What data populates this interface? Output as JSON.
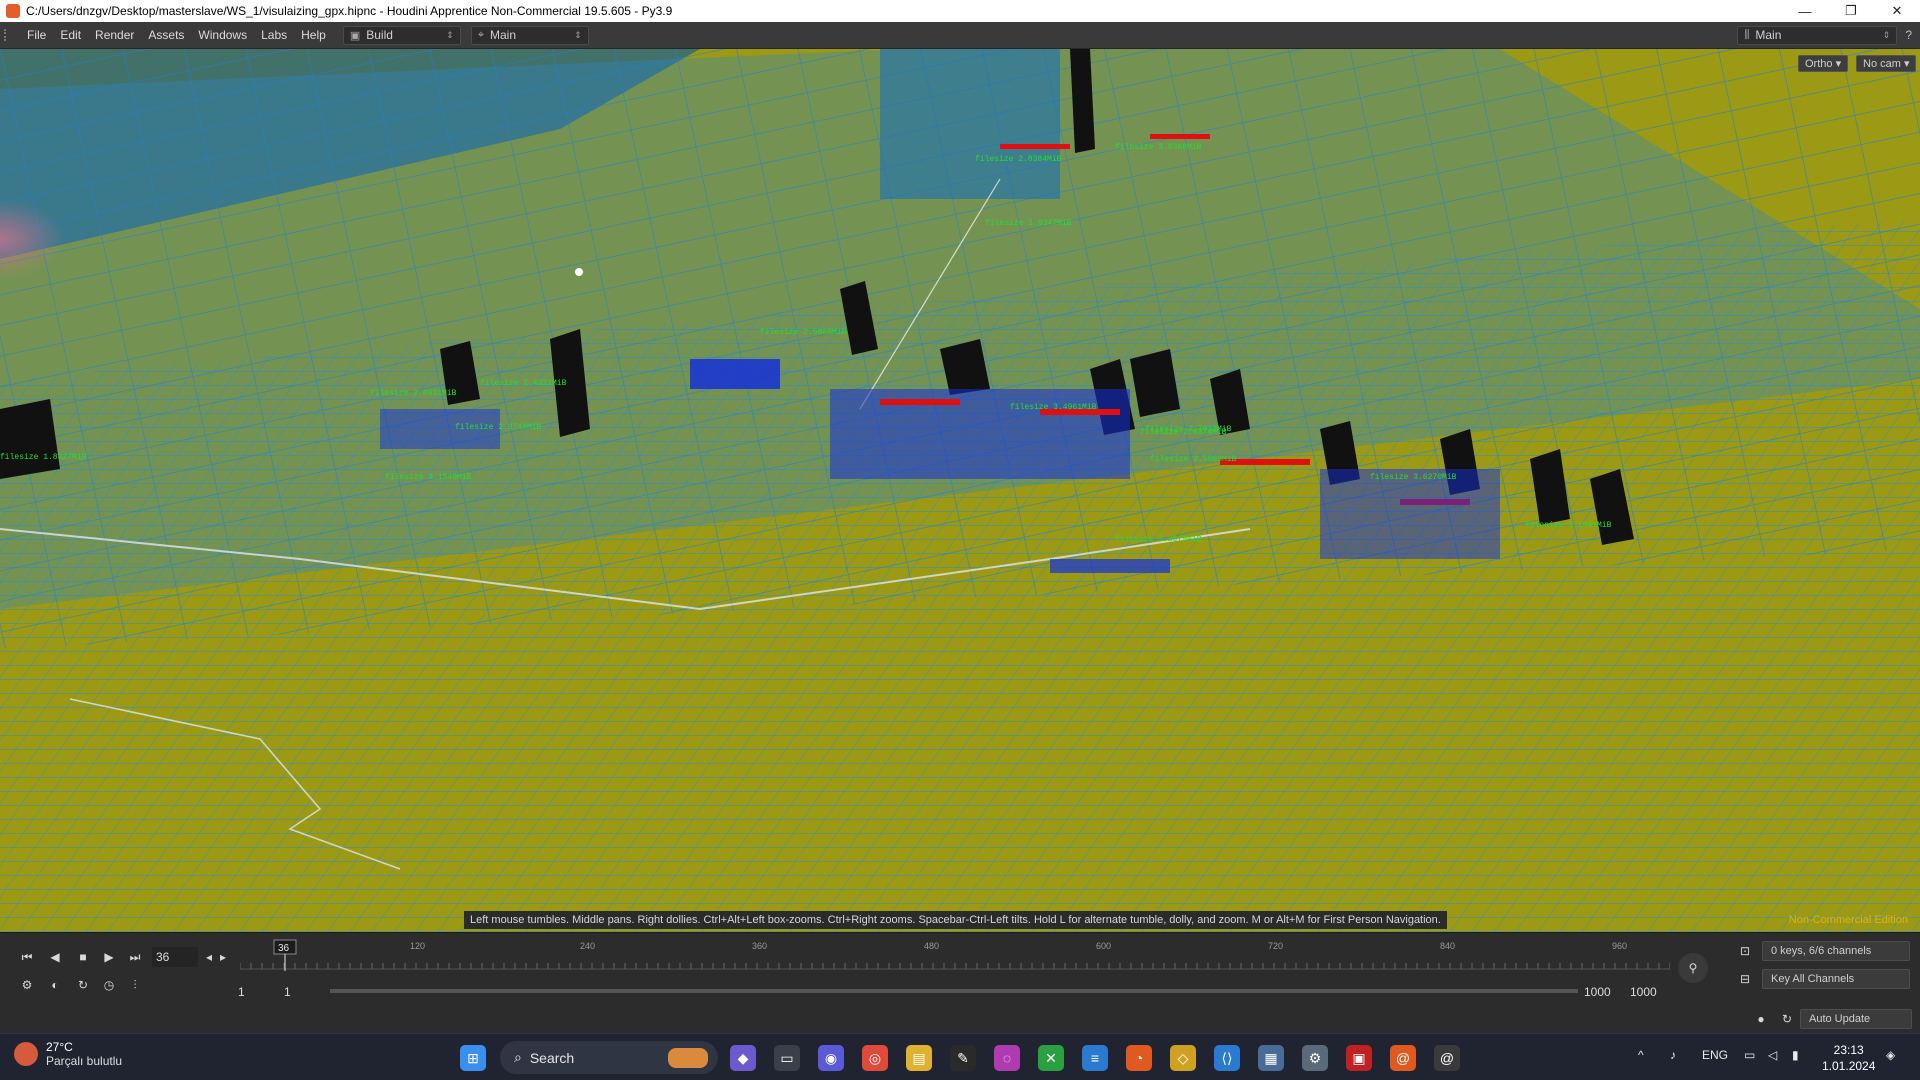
{
  "titlebar": {
    "title": "C:/Users/dnzgv/Desktop/masterslave/WS_1/visulaizing_gpx.hipnc - Houdini Apprentice Non-Commercial 19.5.605 - Py3.9",
    "minimize": "—",
    "maximize": "❐",
    "close": "✕"
  },
  "menubar": {
    "items": [
      "File",
      "Edit",
      "Render",
      "Assets",
      "Windows",
      "Labs",
      "Help"
    ],
    "desktop": "Build",
    "desktop_icon": "layout-icon",
    "network": "Main",
    "network_icon": "crosshair-icon",
    "right_desktop": "Main"
  },
  "viewport": {
    "ortho_button": "Ortho ▾",
    "camera_button": "No cam ▾",
    "hint": "Left mouse tumbles. Middle pans. Right dollies. Ctrl+Alt+Left box-zooms. Ctrl+Right zooms. Spacebar-Ctrl-Left tilts. Hold L for alternate tumble, dolly, and zoom.    M or Alt+M for First Person Navigation.",
    "noncommercial": "Non-Commercial Edition",
    "colors": {
      "terrain": "#9c9a14",
      "lines": "#1f8fd8",
      "labels": "#22e02a",
      "bars": "#111111",
      "markers": "#e01010"
    },
    "labels": [
      "filesize 2.8384MiB",
      "filesize 3.0368MiB",
      "filesize 1.9347MiB",
      "filesize 2.5868MiB",
      "filesize 2.4321MiB",
      "filesize 2.4931MiB",
      "filesize 2.3749MiB",
      "filesize 3.1549MiB",
      "filesize 1.8327MiB",
      "filesize 3.4961MiB",
      "filesize 2.6374MiB",
      "filesize 2.5069MiB",
      "filesize 3.6270MiB",
      "filesize 3.1941MiB",
      "filesize 3.2079MiB",
      "filesize 2.7013MiB"
    ]
  },
  "timeline": {
    "current_frame": "36",
    "frame_marker": "36",
    "ticks": [
      "120",
      "240",
      "360",
      "480",
      "600",
      "720",
      "840",
      "960"
    ],
    "start": "1",
    "start2": "1",
    "end": "1000",
    "end2": "1000",
    "keys_info": "0 keys, 6/6 channels",
    "key_all": "Key All Channels",
    "auto_update": "Auto Update"
  },
  "taskbar": {
    "weather_temp": "27°C",
    "weather_text": "Parçalı bulutlu",
    "search": "Search",
    "language": "ENG",
    "time": "23:13",
    "date": "1.01.2024"
  }
}
